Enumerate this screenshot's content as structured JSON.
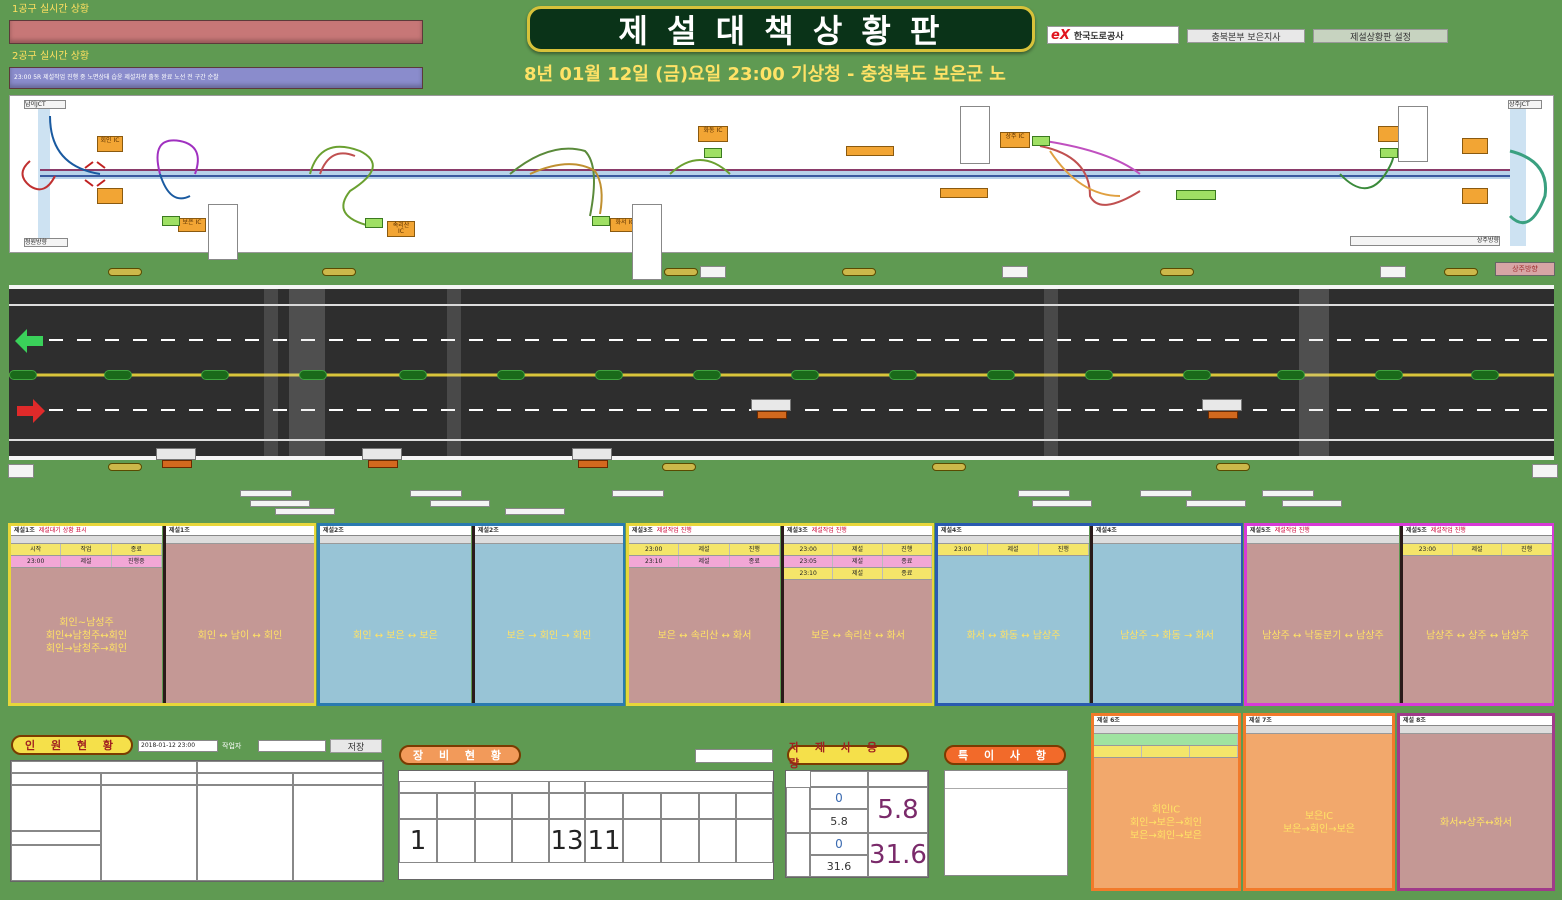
{
  "header": {
    "line1_label": "1공구 실시간 상황",
    "line2_label": "2공구 실시간 상황",
    "line2_text": "23:00 5R 제설작업 진행 중 노면상태 습윤 제설차량 출동 완료 노선 전 구간 순찰",
    "title": "제 설 대 책   상 황 판",
    "weather": "8년 01월 12일 (금)요일 23:00 기상청 - 충청북도 보은군 노",
    "logo_text": "한국도로공사",
    "logo_mark": "eX",
    "office_box": "충북본부 보은지사",
    "button_right": "제설상황판 설정",
    "colors": {
      "title_bg": "#0a3318",
      "title_border": "#d7c23a",
      "accent_yellow": "#ffe266",
      "bg": "#5f9a52"
    }
  },
  "map": {
    "left_label": "남이JCT",
    "right_label": "상주JCT",
    "bottom_left": "청원방향",
    "bottom_right": "상주방향",
    "tags": [
      "회인 IC",
      "보은 IC",
      "속리산 IC",
      "화서 IC",
      "화동 IC",
      "상주 IC"
    ]
  },
  "road": {
    "left_arrow_icon": "arrow-left-icon",
    "right_arrow_icon": "arrow-right-icon",
    "right_badge": "상주방향"
  },
  "panels": [
    {
      "hdr": "제설1조",
      "note": "제설대기 상황 표시",
      "rows": [
        [
          "시작",
          "작업",
          "종료"
        ],
        [
          "23:00",
          "제설",
          "진행중"
        ]
      ],
      "route": "회인~남성주\n회인↔남청주↔회인\n회인→남청주→회인",
      "bg": "#c49895"
    },
    {
      "hdr": "제설1조",
      "note": "",
      "rows": [],
      "route": "회인 ↔ 남이 ↔ 회인",
      "bg": "#c49895"
    },
    {
      "hdr": "제설2조",
      "note": "",
      "rows": [],
      "route": "회인 ↔ 보은 ↔ 보은",
      "bg": "#98c4d6"
    },
    {
      "hdr": "제설2조",
      "note": "",
      "rows": [],
      "route": "보은 → 회인 → 회인",
      "bg": "#98c4d6"
    },
    {
      "hdr": "제설3조",
      "note": "제설작업 진행",
      "rows": [
        [
          "23:00",
          "제설",
          "진행"
        ],
        [
          "23:10",
          "제설",
          "종료"
        ]
      ],
      "route": "보은 ↔ 속리산 ↔ 화서",
      "bg": "#c49895"
    },
    {
      "hdr": "제설3조",
      "note": "제설작업 진행",
      "rows": [
        [
          "23:00",
          "제설",
          "진행"
        ],
        [
          "23:05",
          "제설",
          "종료"
        ],
        [
          "23:10",
          "제설",
          "종료"
        ]
      ],
      "route": "보은 ↔ 속리산 ↔ 화서",
      "bg": "#c49895"
    },
    {
      "hdr": "제설4조",
      "note": "",
      "rows": [
        [
          "23:00",
          "제설",
          "진행"
        ]
      ],
      "route": "화서 ↔ 화동 ↔ 남상주",
      "bg": "#98c4d6"
    },
    {
      "hdr": "제설4조",
      "note": "",
      "rows": [],
      "route": "남상주 → 화동 → 화서",
      "bg": "#98c4d6"
    },
    {
      "hdr": "제설5조",
      "note": "제설작업 진행",
      "rows": [],
      "route": "남상주 ↔ 낙동분기 ↔ 남상주",
      "bg": "#c49895"
    },
    {
      "hdr": "제설5조",
      "note": "제설작업 진행",
      "rows": [
        [
          "23:00",
          "제설",
          "진행"
        ]
      ],
      "route": "남상주 ↔ 상주 ↔ 남상주",
      "bg": "#c49895"
    }
  ],
  "bottom": {
    "staff_title": "인 원 현 황",
    "staff_date": "2018-01-12 23:00",
    "staff_label": "작업자",
    "staff_button": "저장",
    "equip_title": "장 비 현 황",
    "equip_values": [
      "1",
      "13",
      "11"
    ],
    "mat_title": "자 재 사 용 량",
    "mat_small": [
      "0",
      "5.8",
      "0",
      "31.6"
    ],
    "mat_big": [
      "5.8",
      "31.6"
    ],
    "note_title": "특 이 사 항"
  },
  "right_cards": [
    {
      "hdr": "제설 6조",
      "route": "회인IC\n회인→보은→회인\n보은→회인→보은",
      "bg": "#f2a86c"
    },
    {
      "hdr": "제설 7조",
      "route": "보은IC\n보은→회인→보은",
      "bg": "#f2a86c"
    },
    {
      "hdr": "제설 8조",
      "route": "화서↔상주↔화서",
      "bg": "#c49895"
    }
  ]
}
